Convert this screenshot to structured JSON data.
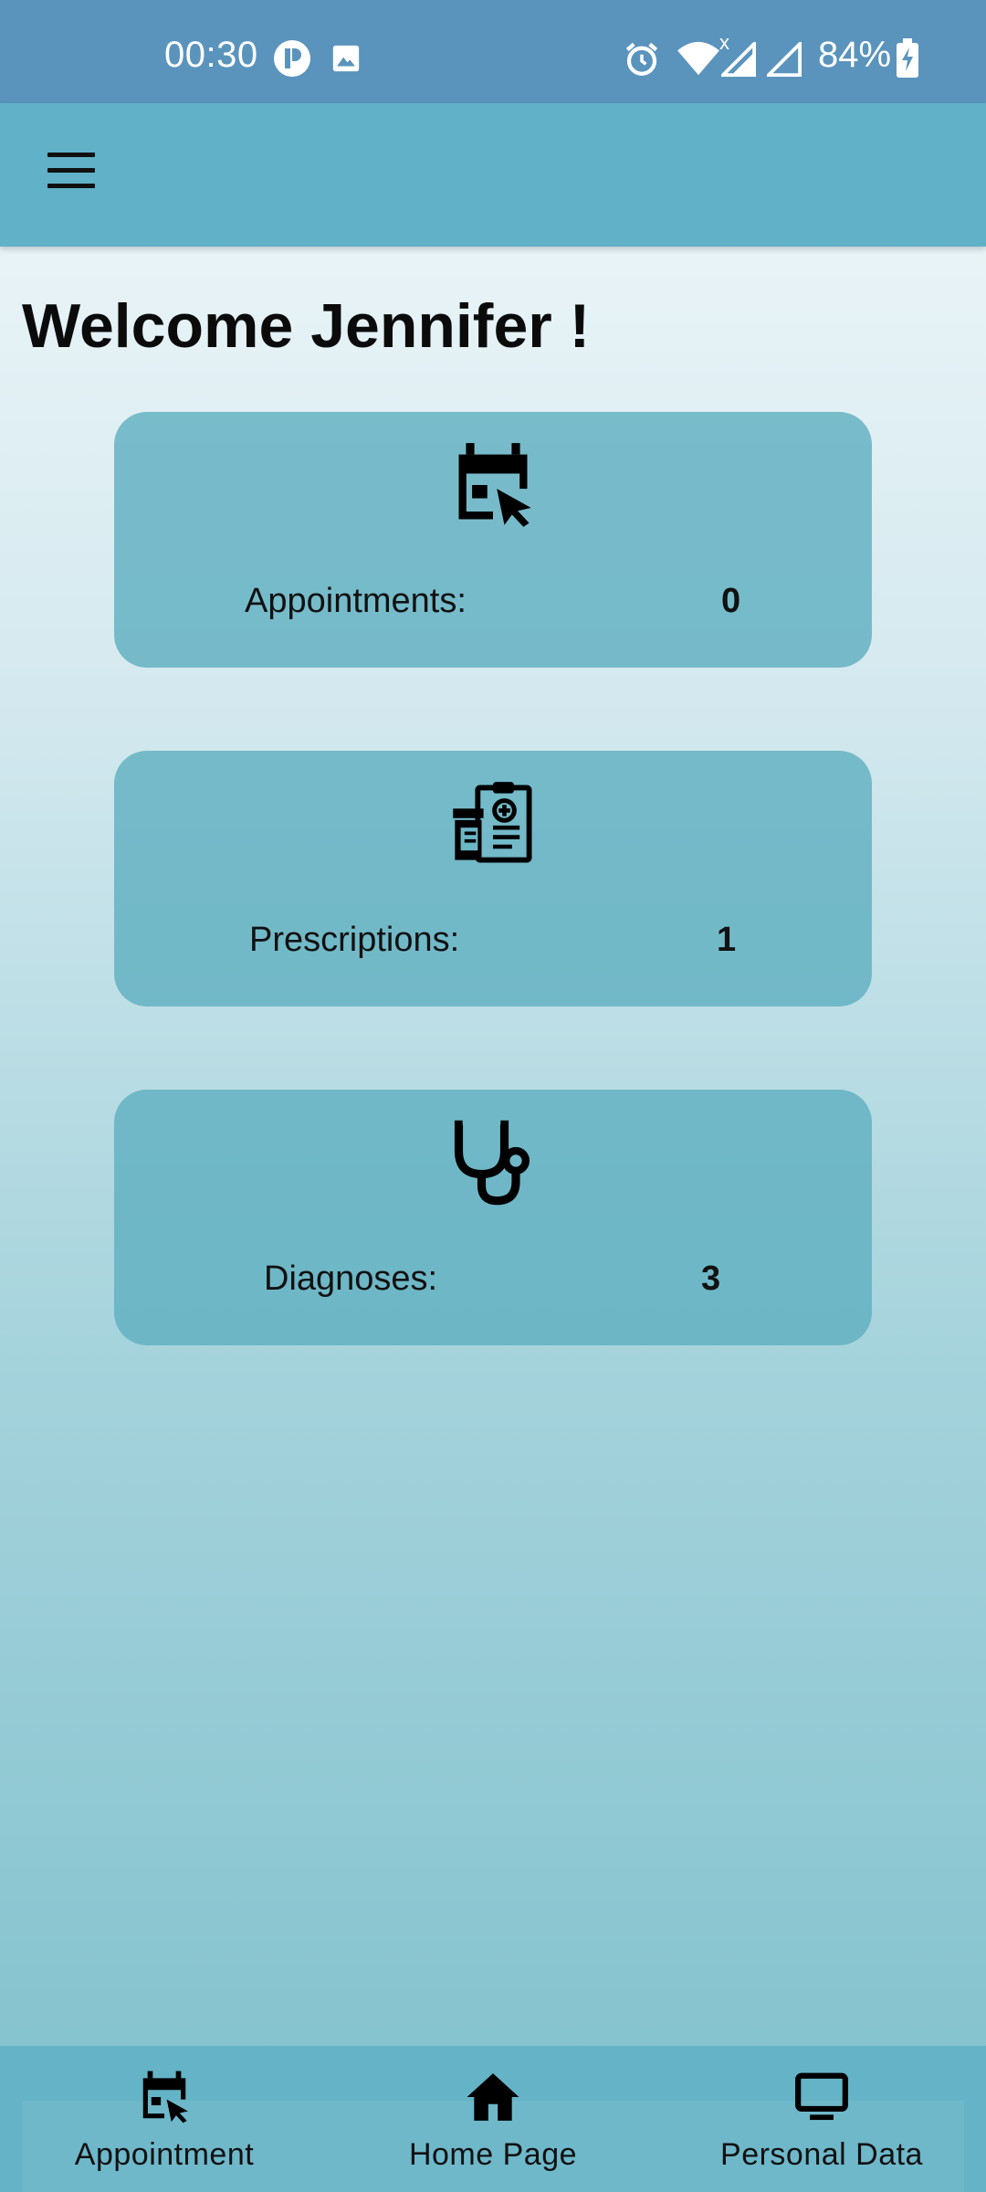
{
  "status_bar": {
    "time": "00:30",
    "battery": "84%",
    "icons": [
      "app-notification-icon",
      "gallery-icon",
      "alarm-icon",
      "wifi-icon",
      "signal-icon",
      "signal-icon",
      "battery-charging-icon"
    ]
  },
  "app_bar": {
    "menu_icon": "hamburger-menu-icon"
  },
  "main": {
    "welcome": "Welcome Jennifer !",
    "cards": [
      {
        "label": "Appointments:",
        "value": "0",
        "icon": "calendar-cursor-icon"
      },
      {
        "label": "Prescriptions:",
        "value": "1",
        "icon": "prescription-clipboard-icon"
      },
      {
        "label": "Diagnoses:",
        "value": "3",
        "icon": "stethoscope-icon"
      }
    ]
  },
  "bottom_nav": {
    "items": [
      {
        "label": "Appointment",
        "icon": "calendar-cursor-icon"
      },
      {
        "label": "Home Page",
        "icon": "home-icon"
      },
      {
        "label": "Personal Data",
        "icon": "monitor-icon"
      }
    ]
  },
  "colors": {
    "status_bar": "#5a94bd",
    "app_bar": "#61b1c8",
    "card": "#60b0c1",
    "bottom_nav": "#64b3c6"
  }
}
